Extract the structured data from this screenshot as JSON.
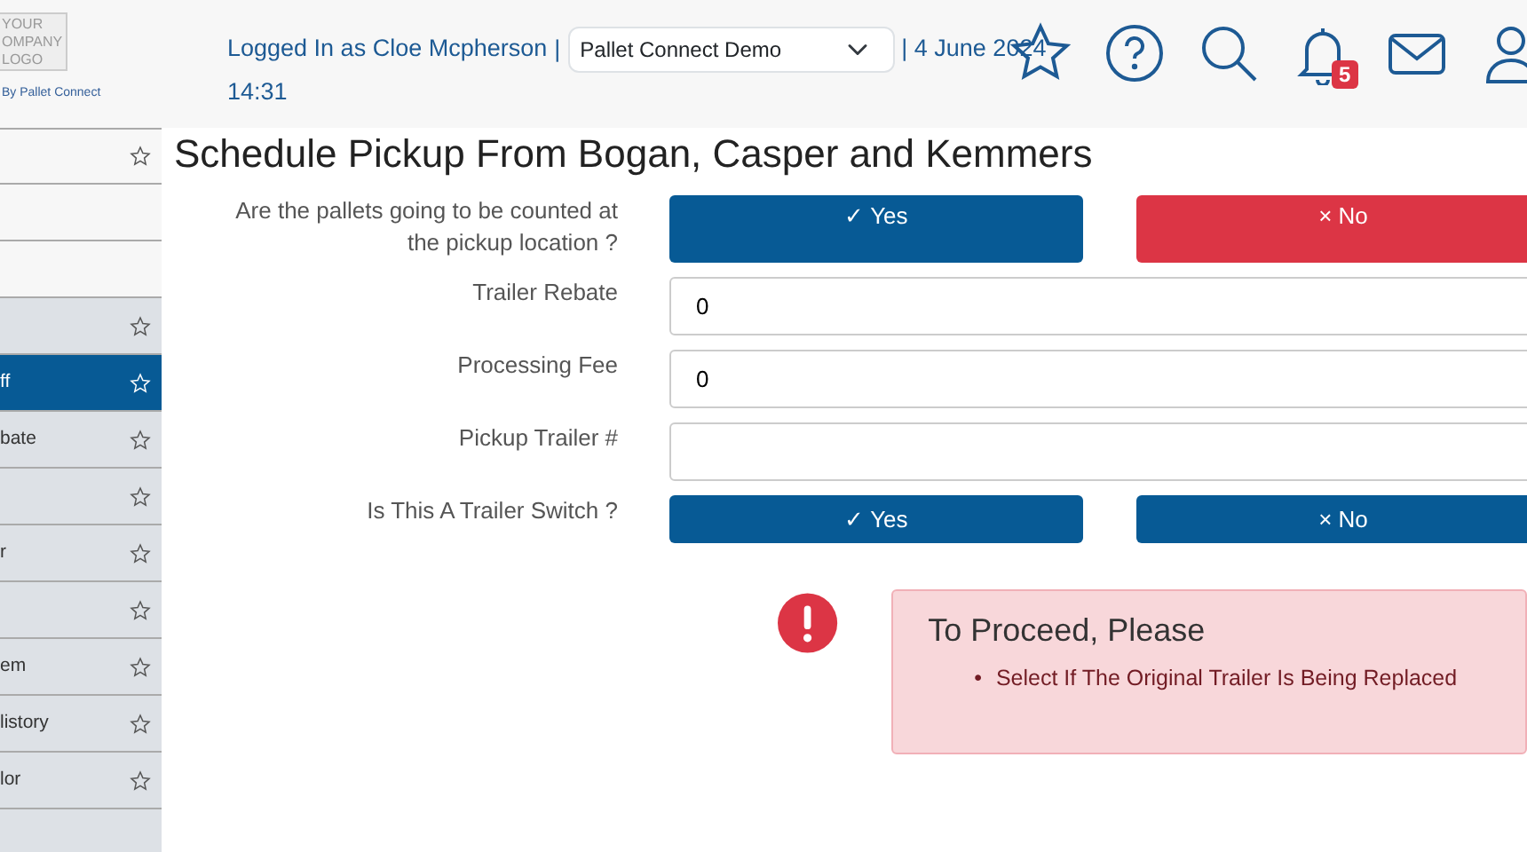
{
  "header": {
    "logo_lines": [
      "YOUR",
      "OMPANY",
      "LOGO"
    ],
    "logo_caption": "By Pallet Connect",
    "logged_in": "Logged In as Cloe Mcpherson",
    "separator": "|",
    "company_select": "Pallet Connect Demo",
    "date": "| 4 June 2024",
    "time": "14:31",
    "notification_count": "5"
  },
  "sidebar": {
    "items": [
      {
        "star": true,
        "selected": false,
        "shade": false
      },
      {
        "star": false,
        "selected": false,
        "shade": false
      },
      {
        "star": false,
        "selected": false,
        "shade": false
      },
      {
        "star": true,
        "selected": false,
        "shade": true
      },
      {
        "label": "ff",
        "star": true,
        "selected": true,
        "shade": true
      },
      {
        "label": "bate",
        "star": true,
        "selected": false,
        "shade": true
      },
      {
        "star": true,
        "selected": false,
        "shade": true
      },
      {
        "label": "r",
        "star": true,
        "selected": false,
        "shade": true
      },
      {
        "star": true,
        "selected": false,
        "shade": true
      },
      {
        "label": "em",
        "star": true,
        "selected": false,
        "shade": true
      },
      {
        "label": "listory",
        "star": true,
        "selected": false,
        "shade": true
      },
      {
        "label": "lor",
        "star": true,
        "selected": false,
        "shade": true
      },
      {
        "star": false,
        "selected": false,
        "shade": true
      }
    ]
  },
  "title": "Schedule Pickup From Bogan, Casper and Kemmers",
  "form": [
    {
      "kind": "choice",
      "label": "Are the pallets going to be counted at the pickup location ?",
      "options": [
        {
          "kind": "yes",
          "icon": "✓",
          "text": "Yes",
          "selected": false
        },
        {
          "kind": "no",
          "icon": "×",
          "text": "No",
          "selected": true
        }
      ]
    },
    {
      "kind": "input",
      "label": "Trailer Rebate",
      "value": "0"
    },
    {
      "kind": "input",
      "label": "Processing Fee",
      "value": "0"
    },
    {
      "kind": "input",
      "label": "Pickup Trailer #"
    },
    {
      "kind": "choice",
      "label": "Is This A Trailer Switch ?",
      "options": [
        {
          "kind": "yes",
          "icon": "✓",
          "text": "Yes",
          "selected": false
        },
        {
          "kind": "no",
          "icon": "×",
          "text": "No",
          "selected": false
        }
      ]
    }
  ],
  "alert": {
    "title": "To Proceed, Please",
    "marker": "•",
    "items": [
      "Select If The Original Trailer Is Being Replaced"
    ]
  }
}
